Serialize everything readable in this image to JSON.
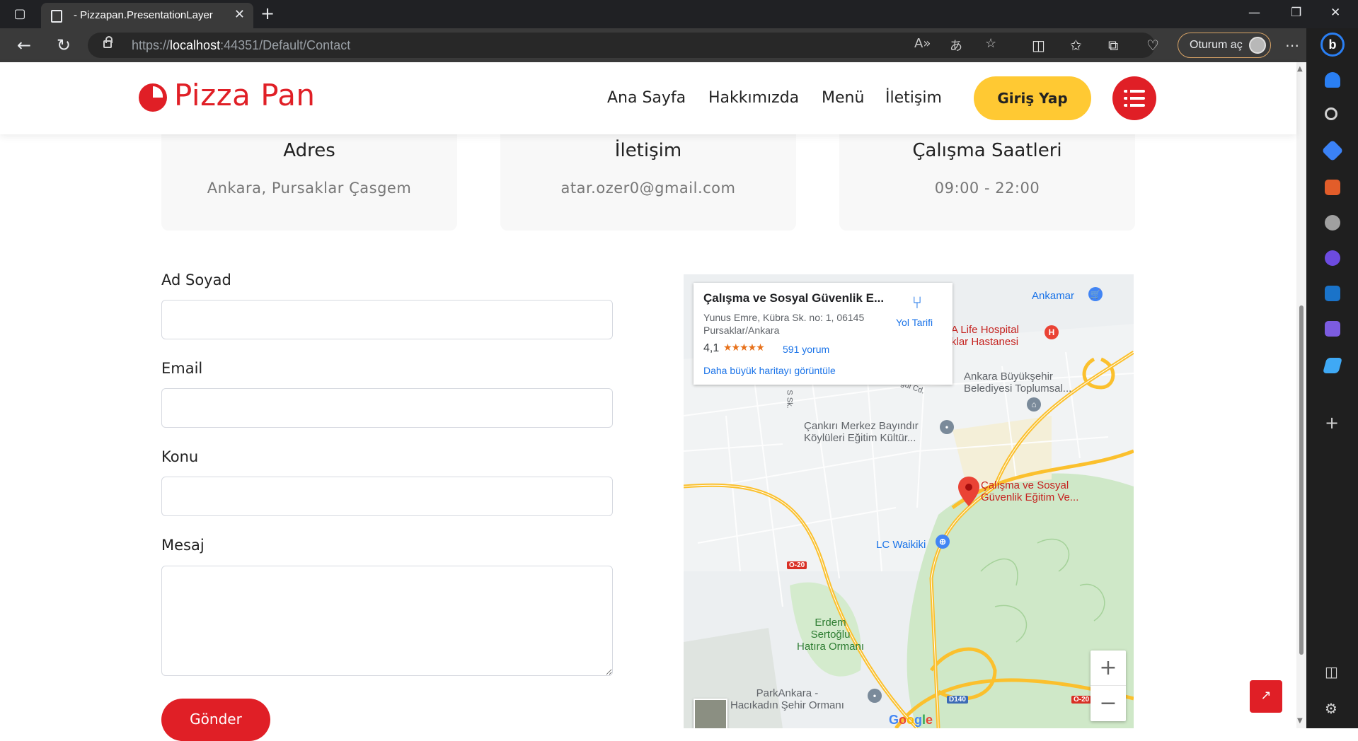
{
  "browser": {
    "tab_title": "- Pizzapan.PresentationLayer",
    "url_scheme": "https://",
    "url_host": "localhost",
    "url_path": ":44351/Default/Contact",
    "signin_label": "Oturum aç",
    "icons": {
      "tab_actions": "tab-actions-icon",
      "back": "back-arrow-icon",
      "refresh": "refresh-icon",
      "read_aloud": "read-aloud-icon",
      "translate": "translate-icon",
      "favorite": "star-icon",
      "split": "split-screen-icon",
      "favorites": "favorites-icon",
      "collections": "collections-icon",
      "health": "browser-essentials-icon",
      "more": "more-icon"
    }
  },
  "header": {
    "logo": "Pizza Pan",
    "nav": [
      "Ana Sayfa",
      "Hakkımızda",
      "Menü",
      "İletişim"
    ],
    "login": "Giriş Yap",
    "brand_color": "#e01f26",
    "button_color": "#ffc933"
  },
  "info_cards": [
    {
      "title": "Adres",
      "text": "Ankara, Pursaklar Çasgem"
    },
    {
      "title": "İletişim",
      "text": "atar.ozer0@gmail.com"
    },
    {
      "title": "Çalışma Saatleri",
      "text": "09:00 - 22:00"
    }
  ],
  "form": {
    "name_label": "Ad Soyad",
    "email_label": "Email",
    "subject_label": "Konu",
    "message_label": "Mesaj",
    "name_value": "",
    "email_value": "",
    "subject_value": "",
    "message_value": "",
    "submit": "Gönder"
  },
  "map": {
    "place_title": "Çalışma ve Sosyal Güvenlik E...",
    "place_address": "Yunus Emre, Kübra Sk. no: 1, 06145 Pursaklar/Ankara",
    "rating": "4,1",
    "stars": "★★★★★",
    "reviews": "591 yorum",
    "larger_map": "Daha büyük haritayı görüntüle",
    "directions": "Yol Tarifi",
    "labels": {
      "ankamar": "Ankamar",
      "hospital_line1": "A Life Hospital",
      "hospital_line2": "klar Hastanesi",
      "municipality_line1": "Ankara Büyükşehir",
      "municipality_line2": "Belediyesi Toplumsal...",
      "school_line1": "Çankırı Merkez Bayındır",
      "school_line2": "Köylüleri Eğitim Kültür...",
      "pin_line1": "Çalışma ve Sosyal",
      "pin_line2": "Güvenlik Eğitim Ve...",
      "lc_waikiki": "LC Waikiki",
      "forest_line1": "Erdem",
      "forest_line2": "Sertoğlu",
      "forest_line3": "Hatıra Ormanı",
      "park_line1": "ParkAnkara -",
      "park_line2": "Hacıkadın Şehir Ormanı",
      "road_o20": "O-20",
      "road_d140": "D140",
      "road_o20b": "O-20",
      "street_cd": "ğul Cd.",
      "street_sk": "S Sk."
    },
    "google_letters": [
      "G",
      "o",
      "o",
      "g",
      "l",
      "e"
    ],
    "zoom_in": "+",
    "zoom_out": "−"
  }
}
